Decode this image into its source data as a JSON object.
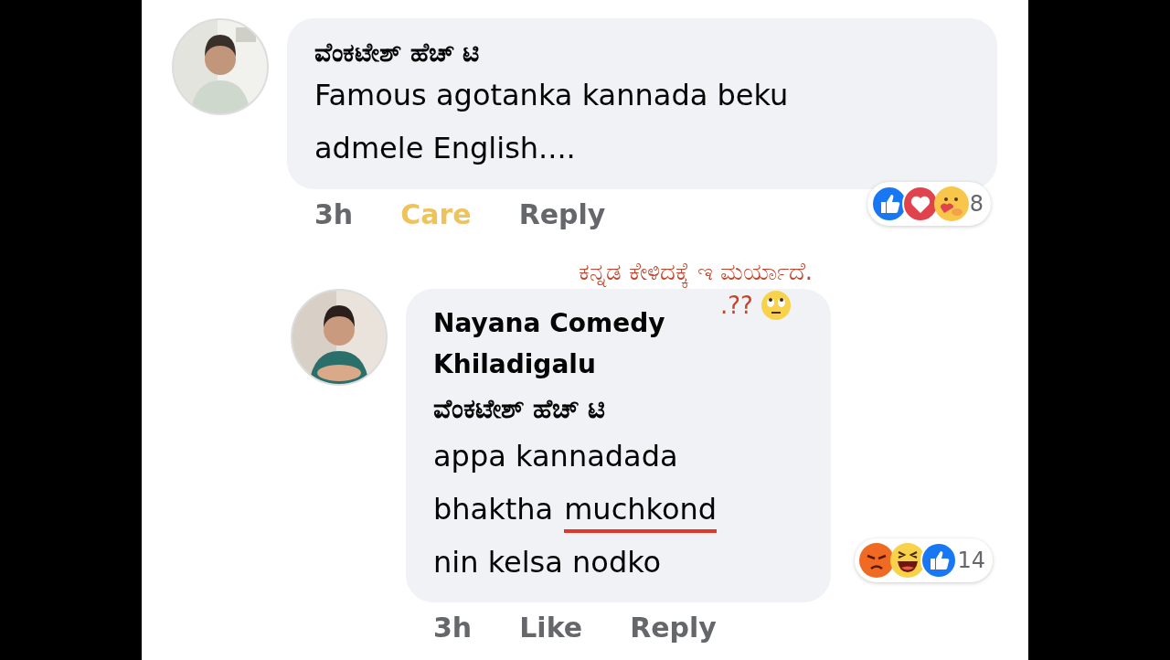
{
  "comments": [
    {
      "author": "ವೆಂಕಟೇಶ್ ಹೆಚ್ ಟಿ",
      "lines": [
        {
          "segments": [
            {
              "text": "Famous agotanka kannada beku",
              "underlined": false
            }
          ]
        },
        {
          "segments": [
            {
              "text": "admele English....",
              "underlined": false
            }
          ]
        }
      ],
      "reactions": {
        "icons": [
          {
            "kind": "like"
          },
          {
            "kind": "love"
          },
          {
            "kind": "care"
          }
        ],
        "count": "8"
      },
      "time": "3h",
      "actions": [
        {
          "label": "Care",
          "selected": true
        },
        {
          "label": "Reply",
          "selected": false
        }
      ]
    },
    {
      "author": "Nayana Comedy Khiladigalu",
      "mention": "ವೆಂಕಟೇಶ್ ಹೆಚ್ ಟಿ",
      "lines": [
        {
          "segments": [
            {
              "text": "appa kannadada",
              "underlined": false
            }
          ]
        },
        {
          "segments": [
            {
              "text": "bhaktha",
              "underlined": false
            },
            {
              "text": "muchkond",
              "underlined": true
            }
          ]
        },
        {
          "segments": [
            {
              "text": "nin kelsa nodko",
              "underlined": false
            }
          ]
        }
      ],
      "reactions": {
        "icons": [
          {
            "kind": "angry"
          },
          {
            "kind": "haha"
          },
          {
            "kind": "like"
          }
        ],
        "count": "14"
      },
      "time": "3h",
      "actions": [
        {
          "label": "Like",
          "selected": false
        },
        {
          "label": "Reply",
          "selected": false
        }
      ]
    }
  ],
  "annotation": {
    "text": "ಕನ್ನಡ ಕೇಳಿದಕ್ಕೆ ಇ ಮರ್ಯಾದೆ.",
    "text_2": ".??"
  }
}
